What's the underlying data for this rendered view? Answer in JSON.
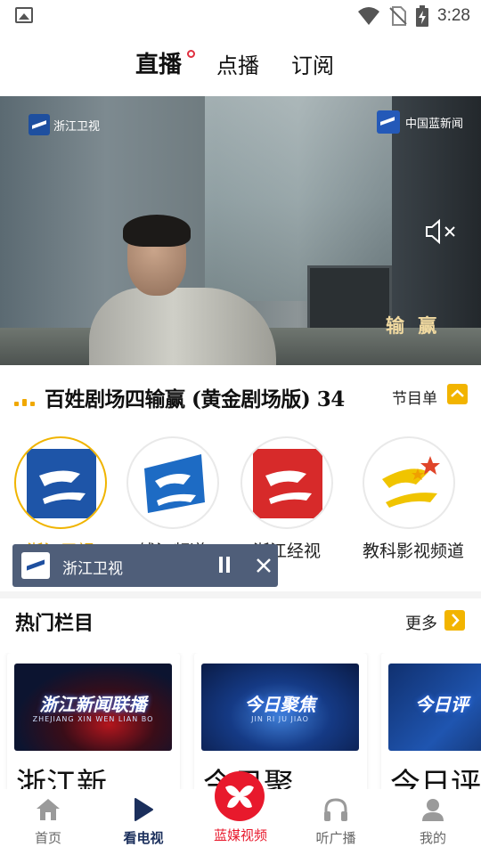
{
  "status_bar": {
    "time": "3:28",
    "icons": [
      "image-icon",
      "wifi-icon",
      "no-sim-icon",
      "battery-charging-icon"
    ]
  },
  "top_tabs": [
    {
      "label": "直播",
      "active": true
    },
    {
      "label": "点播",
      "active": false
    },
    {
      "label": "订阅",
      "active": false
    }
  ],
  "video": {
    "logo_left": "浙江卫视",
    "logo_right": "中国蓝新闻",
    "subtitle": "输 赢",
    "muted": true
  },
  "program": {
    "title": "百姓剧场四输赢 (黄金剧场版) 34",
    "schedule_label": "节目单"
  },
  "channels": [
    {
      "label": "浙江卫视",
      "active": true,
      "color": "#1e55a8"
    },
    {
      "label": "钱江频道",
      "active": false,
      "color": "#1d6bc4"
    },
    {
      "label": "浙江经视",
      "active": false,
      "color": "#d72a2a"
    },
    {
      "label": "教科影视频道",
      "active": false,
      "color": "#f0c400"
    }
  ],
  "mini_player": {
    "title": "浙江卫视"
  },
  "hot": {
    "title": "热门栏目",
    "more_label": "更多",
    "cards": [
      {
        "thumb_title": "浙江新闻联播",
        "thumb_sub": "ZHEJIANG XIN WEN LIAN BO",
        "label": "浙江新"
      },
      {
        "thumb_title": "今日聚焦",
        "thumb_sub": "JIN RI JU JIAO",
        "label": "今日聚"
      },
      {
        "thumb_title": "今日评",
        "thumb_sub": "",
        "label": "今日评"
      }
    ]
  },
  "bottom_nav": [
    {
      "label": "首页",
      "icon": "home-icon",
      "active": false
    },
    {
      "label": "看电视",
      "icon": "play-icon",
      "active": true
    },
    {
      "label": "蓝媒视频",
      "icon": "bluemedia-logo-icon",
      "active": false
    },
    {
      "label": "听广播",
      "icon": "headphones-icon",
      "active": false
    },
    {
      "label": "我的",
      "icon": "profile-icon",
      "active": false
    }
  ],
  "colors": {
    "accent": "#f2b400",
    "brand_red": "#e8192c",
    "nav_active": "#1b2f5c"
  }
}
